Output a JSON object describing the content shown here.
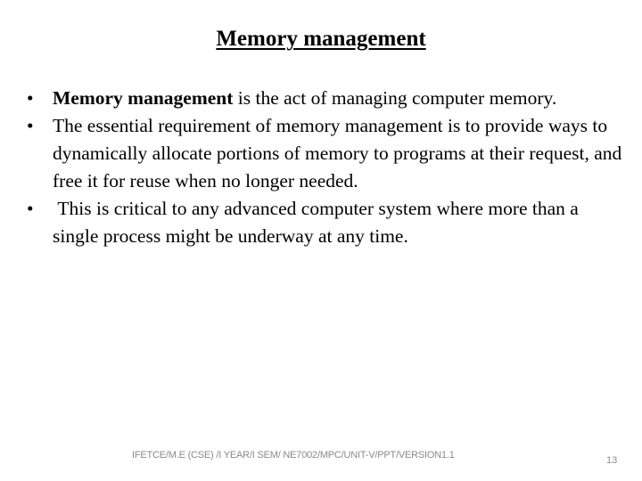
{
  "slide": {
    "title": "Memory management",
    "bullets": [
      {
        "marker": "•",
        "bold_lead": "Memory management",
        "text": " is the act of managing computer memory."
      },
      {
        "marker": "•",
        "bold_lead": "",
        "text": "The essential requirement of memory management is to provide ways to dynamically allocate portions of memory to programs at their request, and free it for reuse when no longer needed."
      },
      {
        "marker": "•",
        "bold_lead": "",
        "text": " This is critical to any advanced computer system where more than a single process might be underway at any time."
      }
    ],
    "footer": "IFETCE/M.E (CSE) /I YEAR/I SEM/ NE7002/MPC/UNIT-V/PPT/VERSION1.1",
    "page_number": "13"
  }
}
